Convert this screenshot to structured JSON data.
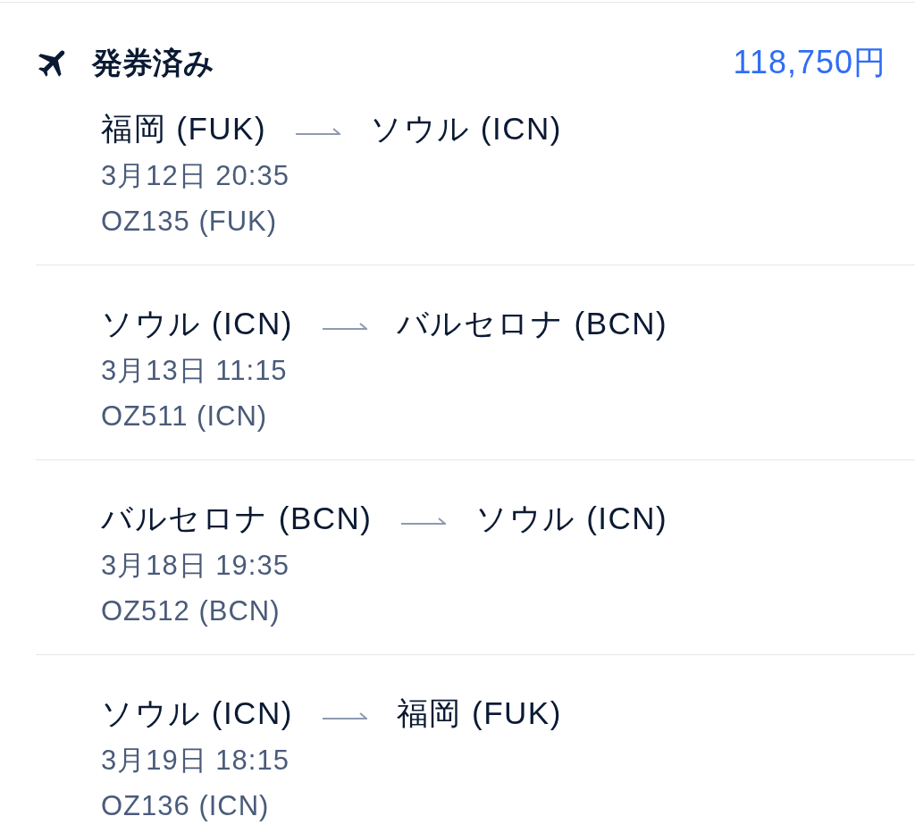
{
  "header": {
    "status": "発券済み",
    "price": "118,750円"
  },
  "segments": [
    {
      "from": "福岡 (FUK)",
      "to": "ソウル (ICN)",
      "datetime": "3月12日 20:35",
      "flight": "OZ135 (FUK)"
    },
    {
      "from": "ソウル (ICN)",
      "to": "バルセロナ (BCN)",
      "datetime": "3月13日 11:15",
      "flight": "OZ511 (ICN)"
    },
    {
      "from": "バルセロナ (BCN)",
      "to": "ソウル (ICN)",
      "datetime": "3月18日 19:35",
      "flight": "OZ512 (BCN)"
    },
    {
      "from": "ソウル (ICN)",
      "to": "福岡 (FUK)",
      "datetime": "3月19日 18:15",
      "flight": "OZ136 (ICN)"
    }
  ]
}
